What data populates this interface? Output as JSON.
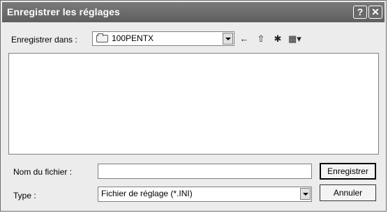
{
  "window": {
    "title": "Enregistrer les réglages",
    "help_icon": "help-question-icon",
    "close_icon": "close-x-icon"
  },
  "save_in": {
    "label": "Enregistrer dans :",
    "value": "100PENTX",
    "icon": "folder-icon"
  },
  "toolbar": {
    "back_icon": "back-arrow-icon",
    "up_icon": "up-folder-icon",
    "new_folder_icon": "new-folder-icon",
    "view_icon": "view-menu-icon"
  },
  "file_list": {
    "items": []
  },
  "file_name": {
    "label": "Nom du fichier :",
    "value": ""
  },
  "file_type": {
    "label": "Type :",
    "value": "Fichier de réglage (*.INI)"
  },
  "buttons": {
    "save_label": "Enregistrer",
    "cancel_label": "Annuler"
  }
}
